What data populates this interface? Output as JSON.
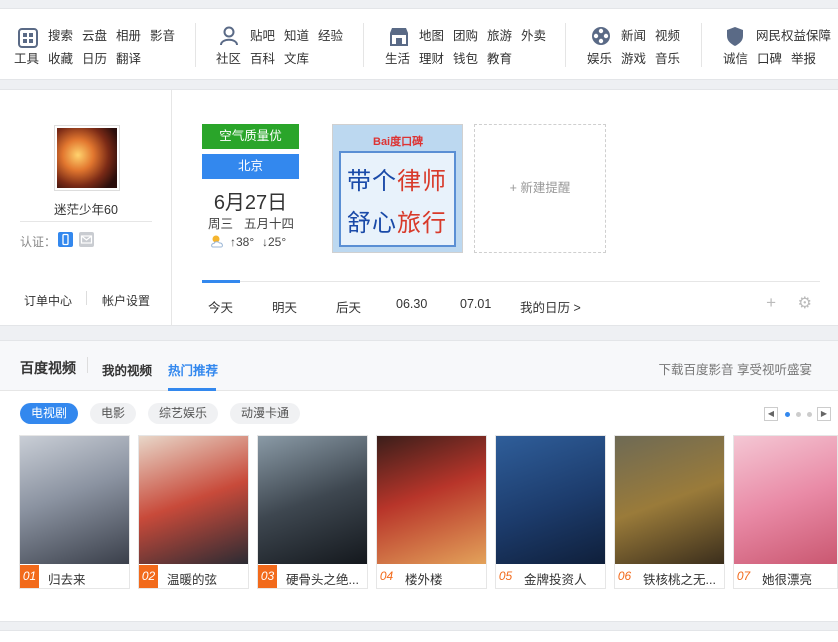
{
  "topnav": {
    "groups": [
      {
        "icon": "grid-tools-icon",
        "links": [
          [
            "搜索",
            "云盘",
            "相册",
            "影音"
          ],
          [
            "工具",
            "收藏",
            "日历",
            "翻译"
          ]
        ]
      },
      {
        "icon": "community-icon",
        "links": [
          [
            "贴吧",
            "知道",
            "经验"
          ],
          [
            "社区",
            "百科",
            "文库"
          ]
        ]
      },
      {
        "icon": "life-shop-icon",
        "links": [
          [
            "地图",
            "团购",
            "旅游",
            "外卖"
          ],
          [
            "生活",
            "理财",
            "钱包",
            "教育"
          ]
        ]
      },
      {
        "icon": "film-reel-icon",
        "links": [
          [
            "新闻",
            "视频"
          ],
          [
            "娱乐",
            "游戏",
            "音乐"
          ]
        ]
      },
      {
        "icon": "shield-icon",
        "links": [
          [
            "网民权益保障"
          ],
          [
            "诚信",
            "口碑",
            "举报"
          ]
        ]
      }
    ]
  },
  "profile": {
    "username": "迷茫少年60",
    "verify_label": "认证：",
    "order_center": "订单中心",
    "account_settings": "帐户设置"
  },
  "weather": {
    "air_quality": "空气质量优",
    "city": "北京",
    "date": "6月27日",
    "weekday": "周三",
    "lunar": "五月十四",
    "temp_high": "↑38°",
    "temp_low": "↓25°",
    "icon": "sun-cloud-icon"
  },
  "ad": {
    "brand": "Bai度口碑",
    "line1_a": "带个",
    "line1_b": "律师",
    "line2_a": "舒心",
    "line2_b": "旅行"
  },
  "reminder": {
    "label": "+ 新建提醒"
  },
  "calendar": {
    "tabs": [
      "今天",
      "明天",
      "后天",
      "06.30",
      "07.01",
      "我的日历 >"
    ],
    "add": "+",
    "settings": "⚙"
  },
  "video": {
    "title": "百度视频",
    "tab_my": "我的视频",
    "tab_hot": "热门推荐",
    "promo": "下载百度影音 享受视听盛宴",
    "pills": [
      "电视剧",
      "电影",
      "综艺娱乐",
      "动漫卡通"
    ],
    "pager_prev": "◀",
    "pager_next": "▶",
    "items": [
      {
        "rank": "01",
        "title": "归去来"
      },
      {
        "rank": "02",
        "title": "温暖的弦"
      },
      {
        "rank": "03",
        "title": "硬骨头之绝..."
      },
      {
        "rank": "04",
        "title": "楼外楼"
      },
      {
        "rank": "05",
        "title": "金牌投资人"
      },
      {
        "rank": "06",
        "title": "铁核桃之无..."
      },
      {
        "rank": "07",
        "title": "她很漂亮"
      }
    ]
  },
  "colors": {
    "accent": "#3388ee",
    "air_green": "#2aa52a",
    "rank_orange": "#f26a1b"
  }
}
